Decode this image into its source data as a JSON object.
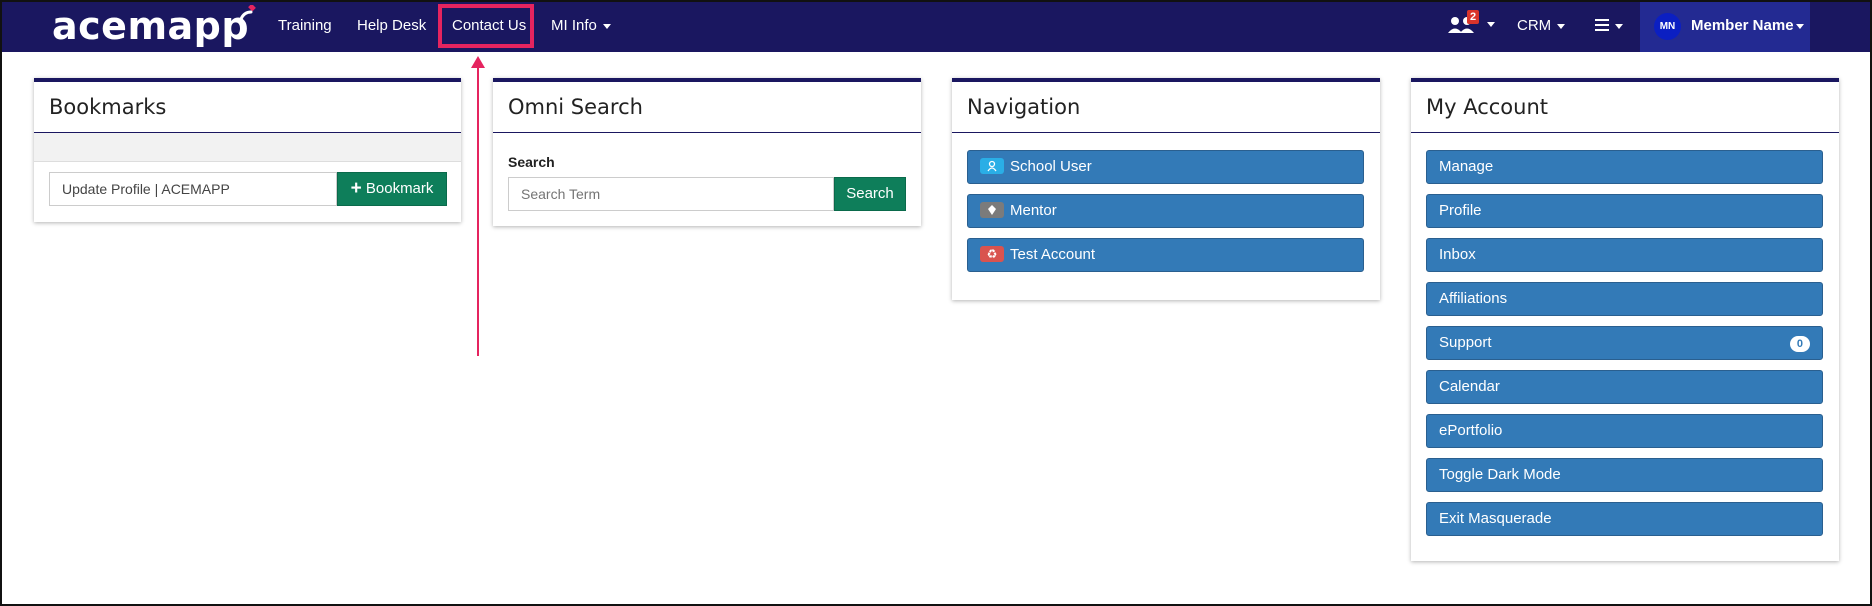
{
  "navbar": {
    "logo_text": "acemapp",
    "links": [
      "Training",
      "Help Desk",
      "Contact Us",
      "MI Info"
    ],
    "users_badge": "2",
    "crm_label": "CRM",
    "avatar_initials": "MN",
    "member_name": "Member Name"
  },
  "bookmarks": {
    "title": "Bookmarks",
    "input_value": "Update Profile | ACEMAPP",
    "button_label": "Bookmark"
  },
  "omni_search": {
    "title": "Omni Search",
    "label": "Search",
    "placeholder": "Search Term",
    "button_label": "Search"
  },
  "navigation": {
    "title": "Navigation",
    "items": [
      {
        "label": "School User",
        "icon": "user-icon",
        "icon_color": "#2aaee6"
      },
      {
        "label": "Mentor",
        "icon": "mentor-icon",
        "icon_color": "#7b7b7b"
      },
      {
        "label": "Test Account",
        "icon": "recycle-icon",
        "icon_color": "#d9534f"
      }
    ]
  },
  "my_account": {
    "title": "My Account",
    "items": [
      "Manage",
      "Profile",
      "Inbox",
      "Affiliations",
      "Support",
      "Calendar",
      "ePortfolio",
      "Toggle Dark Mode",
      "Exit Masquerade"
    ],
    "support_count": "0"
  },
  "colors": {
    "navbar": "#1a1760",
    "member_area": "#232a92",
    "accent_green": "#0e7e5a",
    "button_blue": "#337ab7",
    "highlight": "#e5245f"
  }
}
